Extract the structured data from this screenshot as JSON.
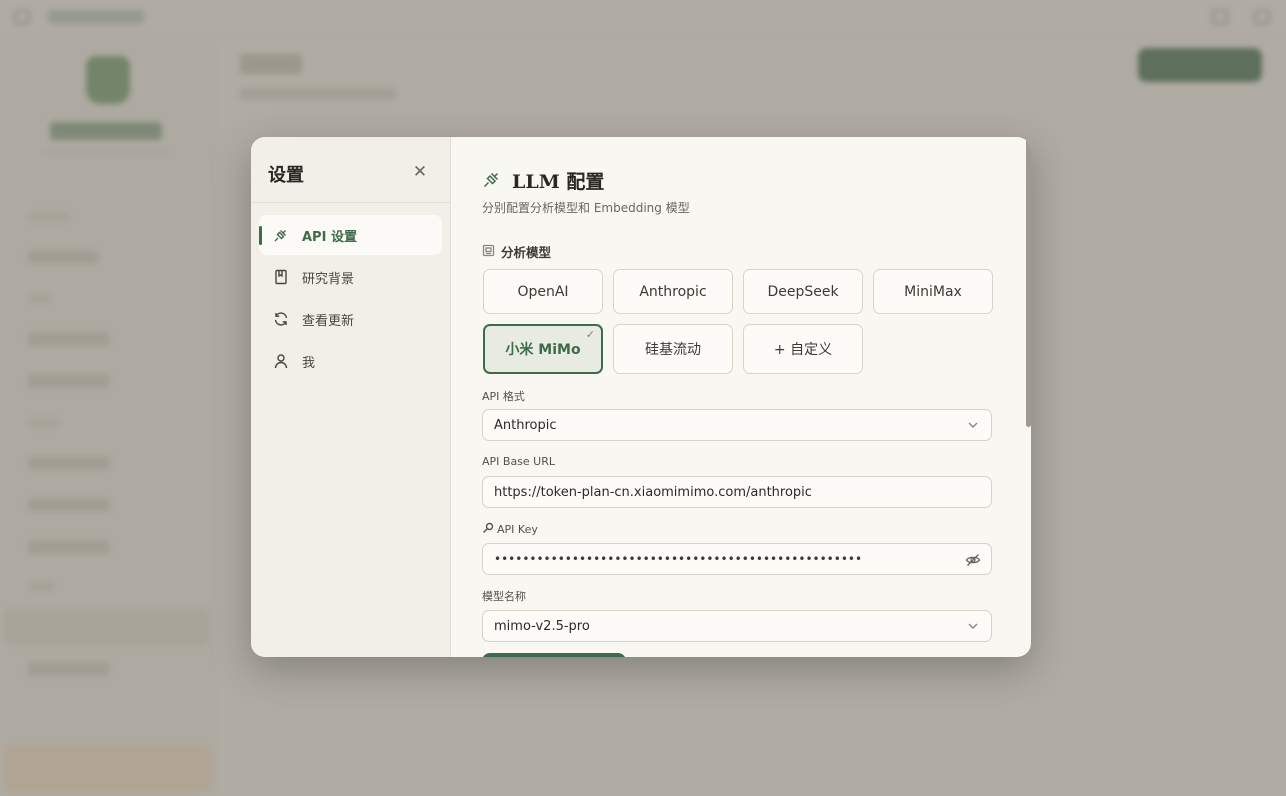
{
  "modal": {
    "title": "设置",
    "close_icon": "close-icon",
    "nav": [
      {
        "label": "API 设置",
        "icon": "plug-icon",
        "active": true
      },
      {
        "label": "研究背景",
        "icon": "book-icon",
        "active": false
      },
      {
        "label": "查看更新",
        "icon": "refresh-icon",
        "active": false
      },
      {
        "label": "我",
        "icon": "user-icon",
        "active": false
      }
    ]
  },
  "llm": {
    "title": "LLM 配置",
    "subtitle": "分别配置分析模型和 Embedding 模型",
    "analysis_label": "分析模型",
    "providers": [
      "OpenAI",
      "Anthropic",
      "DeepSeek",
      "MiniMax",
      "小米 MiMo",
      "硅基流动",
      "+ 自定义"
    ],
    "selected_provider": "小米 MiMo",
    "api_format_label": "API 格式",
    "api_format_value": "Anthropic",
    "base_url_label": "API Base URL",
    "base_url_value": "https://token-plan-cn.xiaomimimo.com/anthropic",
    "api_key_label": "API Key",
    "api_key_value": "••••••••••••••••••••••••••••••••••••••••••••••••••••",
    "model_name_label": "模型名称",
    "model_name_value": "mimo-v2.5-pro"
  },
  "colors": {
    "accent": "#3f6b4b",
    "overlay": "#78736955",
    "modal_bg": "#f8f7f2"
  }
}
